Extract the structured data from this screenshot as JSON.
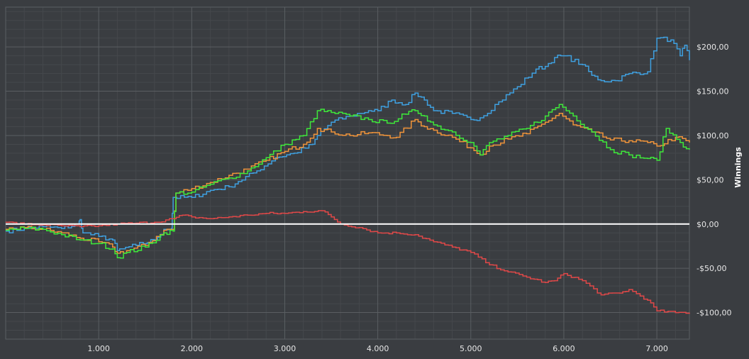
{
  "chart_data": {
    "type": "line",
    "title": "",
    "xlabel": "",
    "ylabel": "Winnings",
    "xlim": [
      0,
      7350
    ],
    "ylim": [
      -130,
      245
    ],
    "x_ticks": [
      1000,
      2000,
      3000,
      4000,
      5000,
      6000,
      7000
    ],
    "x_tick_labels": [
      "1.000",
      "2.000",
      "3.000",
      "4.000",
      "5.000",
      "6.000",
      "7.000"
    ],
    "y_ticks": [
      -100,
      -50,
      0,
      50,
      100,
      150,
      200
    ],
    "y_tick_labels": [
      "-$100,00",
      "-$50,00",
      "$0,00",
      "$50,00",
      "$100,00",
      "$150,00",
      "$200,00"
    ],
    "grid": true,
    "legend": "none",
    "zero_line_color": "#ffffff",
    "background_color": "#3a3d41",
    "grid_major_color": "#5a5e62",
    "grid_minor_color": "#45484c",
    "series": [
      {
        "color": "#3fa0e0",
        "points": [
          [
            0,
            -8
          ],
          [
            200,
            -5
          ],
          [
            400,
            -3
          ],
          [
            600,
            -5
          ],
          [
            780,
            0
          ],
          [
            800,
            5
          ],
          [
            830,
            -10
          ],
          [
            1000,
            -14
          ],
          [
            1150,
            -18
          ],
          [
            1200,
            -30
          ],
          [
            1250,
            -28
          ],
          [
            1400,
            -24
          ],
          [
            1600,
            -18
          ],
          [
            1700,
            -6
          ],
          [
            1780,
            -5
          ],
          [
            1800,
            30
          ],
          [
            2000,
            30
          ],
          [
            2200,
            38
          ],
          [
            2400,
            42
          ],
          [
            2500,
            48
          ],
          [
            2700,
            60
          ],
          [
            2900,
            75
          ],
          [
            3100,
            80
          ],
          [
            3300,
            90
          ],
          [
            3350,
            100
          ],
          [
            3500,
            115
          ],
          [
            3700,
            122
          ],
          [
            3900,
            128
          ],
          [
            4000,
            128
          ],
          [
            4150,
            140
          ],
          [
            4300,
            135
          ],
          [
            4400,
            148
          ],
          [
            4500,
            140
          ],
          [
            4600,
            128
          ],
          [
            4800,
            125
          ],
          [
            5000,
            118
          ],
          [
            5100,
            120
          ],
          [
            5300,
            138
          ],
          [
            5500,
            155
          ],
          [
            5700,
            175
          ],
          [
            5800,
            178
          ],
          [
            5900,
            188
          ],
          [
            6000,
            190
          ],
          [
            6200,
            180
          ],
          [
            6300,
            168
          ],
          [
            6400,
            162
          ],
          [
            6550,
            162
          ],
          [
            6700,
            170
          ],
          [
            6900,
            172
          ],
          [
            7000,
            210
          ],
          [
            7150,
            208
          ],
          [
            7250,
            190
          ],
          [
            7300,
            202
          ],
          [
            7350,
            185
          ]
        ]
      },
      {
        "color": "#f0943a",
        "points": [
          [
            0,
            -6
          ],
          [
            200,
            -4
          ],
          [
            400,
            -6
          ],
          [
            600,
            -10
          ],
          [
            800,
            -16
          ],
          [
            1000,
            -20
          ],
          [
            1150,
            -26
          ],
          [
            1200,
            -33
          ],
          [
            1300,
            -30
          ],
          [
            1500,
            -24
          ],
          [
            1700,
            -7
          ],
          [
            1800,
            -6
          ],
          [
            1830,
            35
          ],
          [
            2000,
            40
          ],
          [
            2200,
            47
          ],
          [
            2400,
            55
          ],
          [
            2600,
            62
          ],
          [
            2800,
            72
          ],
          [
            3000,
            82
          ],
          [
            3200,
            90
          ],
          [
            3350,
            108
          ],
          [
            3500,
            104
          ],
          [
            3700,
            100
          ],
          [
            3900,
            103
          ],
          [
            4100,
            100
          ],
          [
            4200,
            98
          ],
          [
            4400,
            118
          ],
          [
            4500,
            110
          ],
          [
            4600,
            106
          ],
          [
            4800,
            98
          ],
          [
            5000,
            86
          ],
          [
            5100,
            78
          ],
          [
            5200,
            88
          ],
          [
            5400,
            96
          ],
          [
            5600,
            102
          ],
          [
            5800,
            115
          ],
          [
            5950,
            125
          ],
          [
            6100,
            112
          ],
          [
            6300,
            104
          ],
          [
            6500,
            95
          ],
          [
            6700,
            94
          ],
          [
            6900,
            92
          ],
          [
            7000,
            88
          ],
          [
            7200,
            98
          ],
          [
            7350,
            92
          ]
        ]
      },
      {
        "color": "#3ee83a",
        "points": [
          [
            0,
            -7
          ],
          [
            200,
            -5
          ],
          [
            400,
            -6
          ],
          [
            600,
            -12
          ],
          [
            800,
            -18
          ],
          [
            1000,
            -22
          ],
          [
            1150,
            -28
          ],
          [
            1200,
            -38
          ],
          [
            1300,
            -32
          ],
          [
            1500,
            -26
          ],
          [
            1700,
            -10
          ],
          [
            1800,
            -8
          ],
          [
            1830,
            35
          ],
          [
            2000,
            36
          ],
          [
            2200,
            45
          ],
          [
            2400,
            52
          ],
          [
            2600,
            60
          ],
          [
            2800,
            75
          ],
          [
            3000,
            90
          ],
          [
            3200,
            100
          ],
          [
            3350,
            128
          ],
          [
            3500,
            126
          ],
          [
            3700,
            122
          ],
          [
            3900,
            118
          ],
          [
            4100,
            114
          ],
          [
            4300,
            124
          ],
          [
            4400,
            128
          ],
          [
            4500,
            122
          ],
          [
            4600,
            112
          ],
          [
            4800,
            104
          ],
          [
            5000,
            92
          ],
          [
            5100,
            78
          ],
          [
            5200,
            92
          ],
          [
            5400,
            100
          ],
          [
            5600,
            108
          ],
          [
            5800,
            122
          ],
          [
            5950,
            135
          ],
          [
            6100,
            122
          ],
          [
            6300,
            104
          ],
          [
            6500,
            84
          ],
          [
            6700,
            78
          ],
          [
            6900,
            74
          ],
          [
            7000,
            72
          ],
          [
            7100,
            108
          ],
          [
            7250,
            92
          ],
          [
            7350,
            84
          ]
        ]
      },
      {
        "color": "#e04848",
        "points": [
          [
            0,
            2
          ],
          [
            200,
            0
          ],
          [
            400,
            -1
          ],
          [
            600,
            -2
          ],
          [
            800,
            -3
          ],
          [
            1000,
            -2
          ],
          [
            1200,
            0
          ],
          [
            1400,
            1
          ],
          [
            1600,
            2
          ],
          [
            1800,
            6
          ],
          [
            1900,
            10
          ],
          [
            2000,
            8
          ],
          [
            2200,
            6
          ],
          [
            2400,
            8
          ],
          [
            2600,
            10
          ],
          [
            2800,
            12
          ],
          [
            3000,
            12
          ],
          [
            3200,
            14
          ],
          [
            3400,
            15
          ],
          [
            3500,
            8
          ],
          [
            3600,
            0
          ],
          [
            3800,
            -4
          ],
          [
            4000,
            -10
          ],
          [
            4200,
            -10
          ],
          [
            4400,
            -12
          ],
          [
            4600,
            -20
          ],
          [
            4800,
            -26
          ],
          [
            5000,
            -32
          ],
          [
            5200,
            -46
          ],
          [
            5400,
            -54
          ],
          [
            5600,
            -60
          ],
          [
            5800,
            -66
          ],
          [
            5900,
            -64
          ],
          [
            6000,
            -56
          ],
          [
            6200,
            -64
          ],
          [
            6400,
            -80
          ],
          [
            6600,
            -78
          ],
          [
            6700,
            -74
          ],
          [
            6900,
            -86
          ],
          [
            7000,
            -98
          ],
          [
            7200,
            -100
          ],
          [
            7350,
            -100
          ]
        ]
      }
    ]
  }
}
